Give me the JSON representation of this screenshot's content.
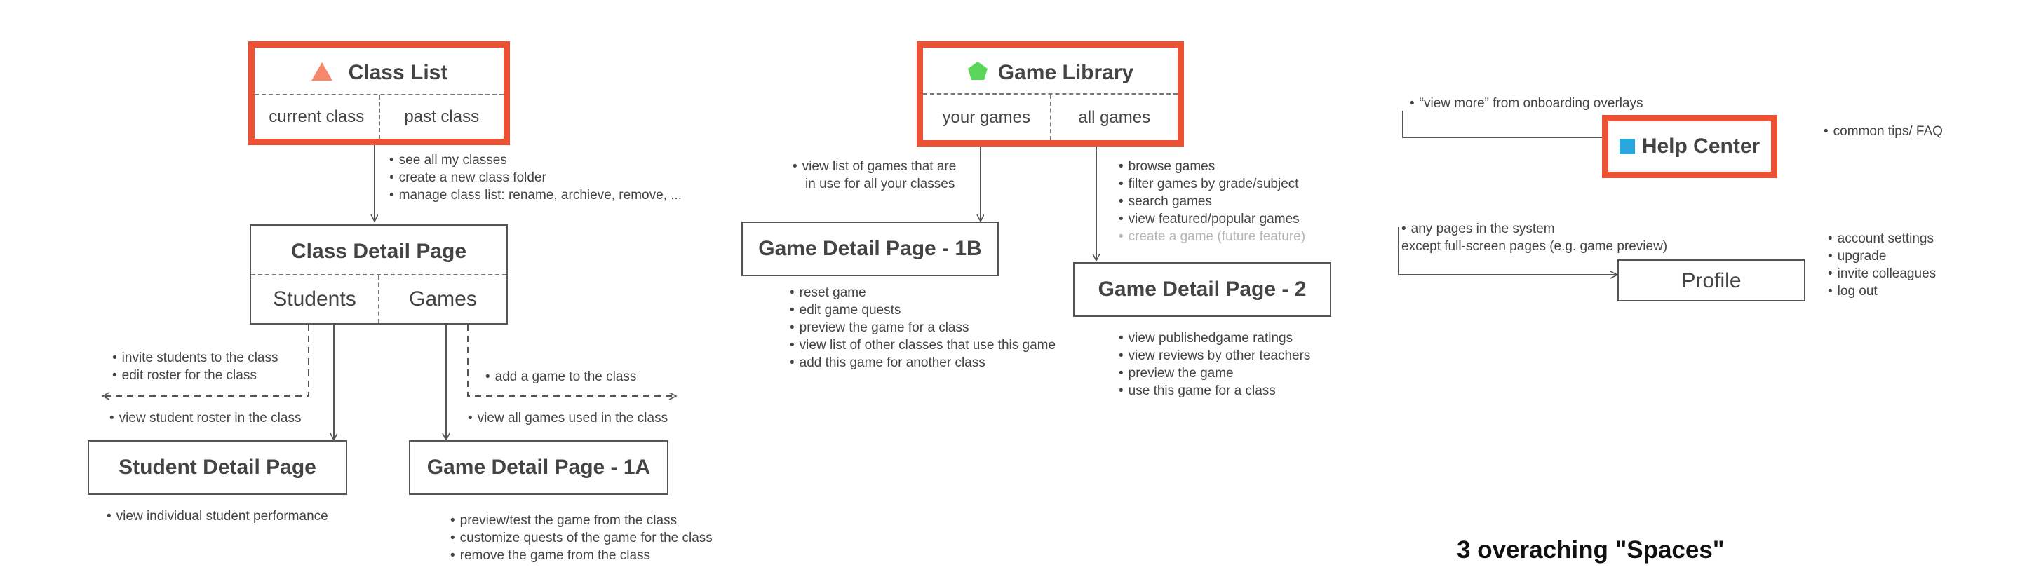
{
  "colors": {
    "accent_border": "#ec5133",
    "triangle": "#f5876a",
    "pentagon": "#5bd65b",
    "square": "#2aa7dc"
  },
  "spaces": {
    "class_list": {
      "icon": "triangle-icon",
      "title": "Class List",
      "tabs": [
        "current class",
        "past class"
      ]
    },
    "game_library": {
      "icon": "pentagon-icon",
      "title": "Game Library",
      "tabs": [
        "your games",
        "all games"
      ]
    },
    "help_center": {
      "icon": "square-icon",
      "title": "Help Center"
    }
  },
  "pages": {
    "class_detail": {
      "title": "Class Detail Page",
      "tabs": [
        "Students",
        "Games"
      ]
    },
    "student_detail": {
      "title": "Student Detail Page"
    },
    "game_detail_1a": {
      "title": "Game Detail Page - 1A"
    },
    "game_detail_1b": {
      "title": "Game Detail Page - 1B"
    },
    "game_detail_2": {
      "title": "Game Detail Page - 2"
    },
    "profile": {
      "title": "Profile"
    }
  },
  "notes": {
    "class_list_actions": [
      "see all my classes",
      "create a new class folder",
      "manage class list: rename, archieve, remove, ..."
    ],
    "students_actions": [
      "invite students to the class",
      "edit roster for the class"
    ],
    "view_roster": [
      "view student roster in the class"
    ],
    "add_game": [
      "add a game to the class"
    ],
    "view_all_games": [
      "view all games used in the class"
    ],
    "student_detail_notes": [
      "view individual student performance"
    ],
    "game_1a_notes": [
      "preview/test the game from the class",
      "customize quests of the game for the class",
      "remove the game from the class"
    ],
    "your_games_notes": [
      "view list of games that are",
      "in use for all your classes"
    ],
    "all_games_notes": [
      "browse games",
      "filter games by grade/subject",
      "search games",
      "view featured/popular games"
    ],
    "all_games_future": "create a game (future feature)",
    "game_1b_notes": [
      "reset game",
      "edit game quests",
      "preview the game for a class",
      "view list of other classes that use this game",
      "add this game for another class"
    ],
    "game_2_notes": [
      "view publishedgame ratings",
      "view reviews by other teachers",
      "preview the game",
      "use this game for a class"
    ],
    "help_entry": [
      "“view more” from onboarding overlays"
    ],
    "help_notes": [
      "common tips/ FAQ"
    ],
    "profile_entry": [
      "any pages in the system",
      "except full-screen pages (e.g. game preview)"
    ],
    "profile_notes": [
      "account settings",
      "upgrade",
      "invite colleagues",
      "log out"
    ]
  },
  "summary": "3 overaching \"Spaces\""
}
